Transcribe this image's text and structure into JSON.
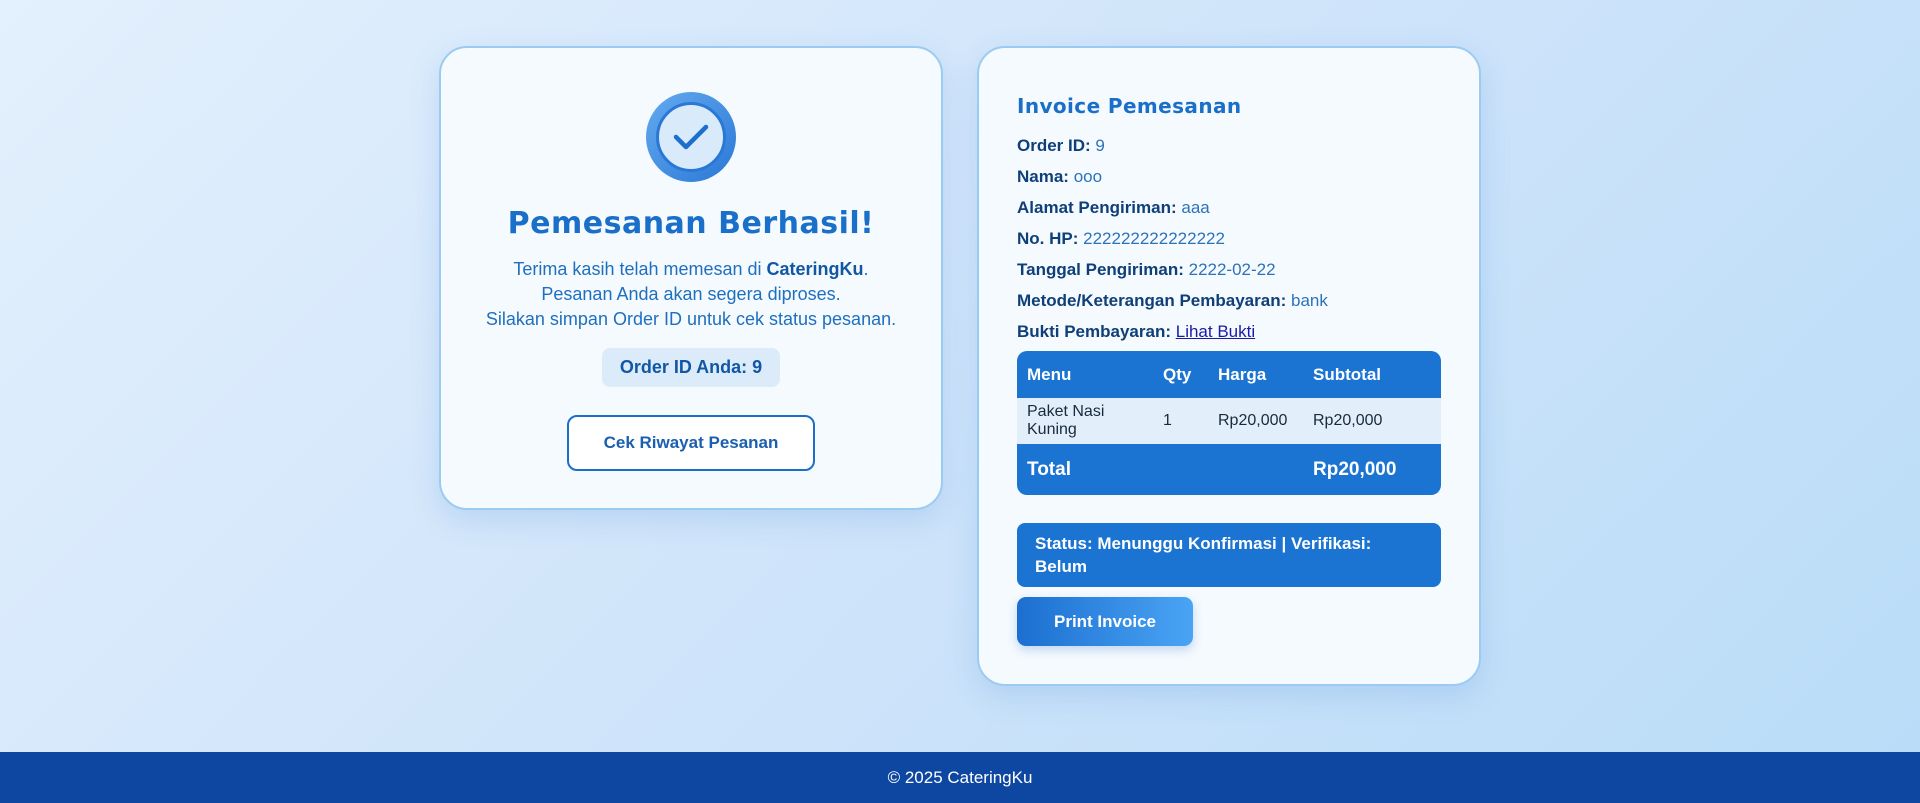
{
  "success": {
    "title": "Pemesanan Berhasil!",
    "line1_prefix": "Terima kasih telah memesan di ",
    "brand": "CateringKu",
    "line1_suffix": ".",
    "line2": "Pesanan Anda akan segera diproses.",
    "line3": "Silakan simpan Order ID untuk cek status pesanan.",
    "order_badge": "Order ID Anda: 9",
    "history_button": "Cek Riwayat Pesanan"
  },
  "invoice": {
    "title": "Invoice Pemesanan",
    "fields": [
      {
        "label": "Order ID:",
        "value": "9"
      },
      {
        "label": "Nama:",
        "value": "ooo"
      },
      {
        "label": "Alamat Pengiriman:",
        "value": "aaa"
      },
      {
        "label": "No. HP:",
        "value": "222222222222222"
      },
      {
        "label": "Tanggal Pengiriman:",
        "value": "2222-02-22"
      },
      {
        "label": "Metode/Keterangan Pembayaran:",
        "value": "bank"
      }
    ],
    "proof_label": "Bukti Pembayaran:",
    "proof_link": "Lihat Bukti",
    "table": {
      "headers": [
        "Menu",
        "Qty",
        "Harga",
        "Subtotal"
      ],
      "rows": [
        [
          "Paket Nasi Kuning",
          "1",
          "Rp20,000",
          "Rp20,000"
        ]
      ],
      "total_label": "Total",
      "total_value": "Rp20,000"
    },
    "status": "Status: Menunggu Konfirmasi | Verifikasi: Belum",
    "print_button": "Print Invoice"
  },
  "footer": {
    "text": "© 2025 CateringKu"
  },
  "colors": {
    "primary": "#1b74d2",
    "footer": "#0e47a1",
    "heading": "#1a6fc9"
  },
  "icons": {
    "success": "check-circle-icon"
  }
}
